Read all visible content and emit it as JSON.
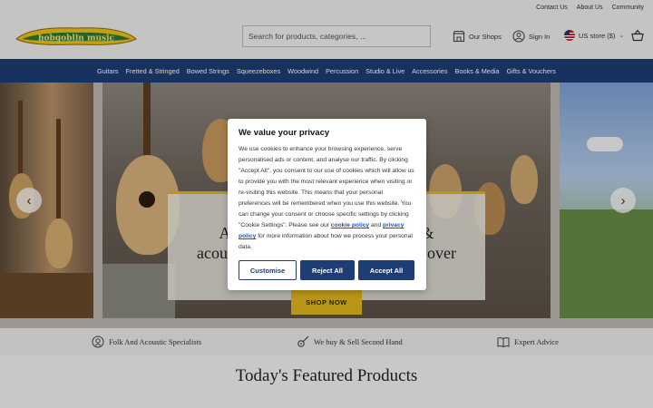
{
  "util_links": [
    "Contact Us",
    "About Us",
    "Community"
  ],
  "header": {
    "logo_text": "hobgoblin music",
    "search_placeholder": "Search for products, categories, ...",
    "our_shops": "Our Shops",
    "sign_in": "Sign In",
    "store": "US store ($)"
  },
  "nav": [
    "Guitars",
    "Fretted & Stringed",
    "Bowed Strings",
    "Squeezeboxes",
    "Woodwind",
    "Percussion",
    "Studio & Live",
    "Accessories",
    "Books & Media",
    "Gifts & Vouchers"
  ],
  "hero": {
    "title_left": "A",
    "title_right": "&",
    "title_line2_left": "acou",
    "title_line2_right": "over",
    "cta": "SHOP NOW"
  },
  "cookie": {
    "title": "We value your privacy",
    "body_1": "We use cookies to enhance your browsing experience, serve personalised ads or content, and analyse our traffic. By clicking \"Accept All\", you consent to our use of cookies which will allow us to provide you with the most relevant experience when visiting or re-visiting this website. This means that your personal preferences will be remembered when you use this website. You can change your consent or choose specific settings by clicking \"Cookie Settings\". Please see our",
    "cookie_policy": "cookie policy",
    "and": "and",
    "privacy_policy": "privacy policy",
    "body_2": "for more information about how we process your personal data.",
    "customise": "Customise",
    "reject": "Reject All",
    "accept": "Accept All"
  },
  "usp": [
    "Folk And Acoustic Specialists",
    "We buy & Sell Second Hand",
    "Expert Advice"
  ],
  "featured_title": "Today's Featured Products",
  "colors": {
    "navy": "#1e3d75",
    "gold": "#e2b81e"
  }
}
